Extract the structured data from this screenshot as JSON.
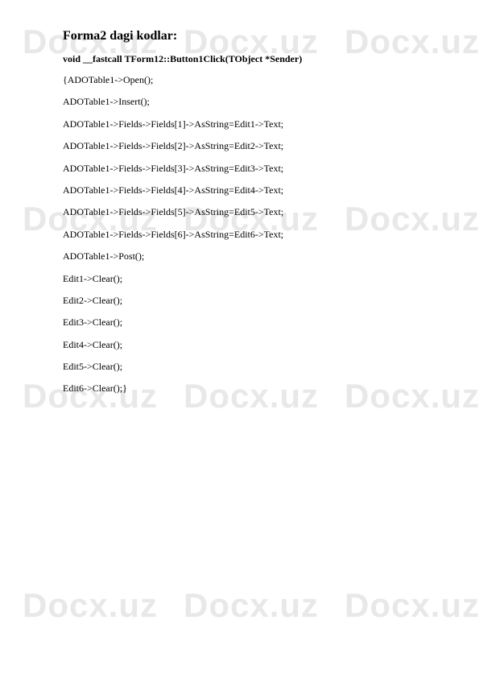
{
  "watermark": "Docx.uz",
  "heading": "Forma2 dagi kodlar:",
  "subheading": "void __fastcall TForm12::Button1Click(TObject *Sender)",
  "lines": [
    "{ADOTable1->Open();",
    "ADOTable1->Insert();",
    "ADOTable1->Fields->Fields[1]->AsString=Edit1->Text;",
    "ADOTable1->Fields->Fields[2]->AsString=Edit2->Text;",
    "ADOTable1->Fields->Fields[3]->AsString=Edit3->Text;",
    "ADOTable1->Fields->Fields[4]->AsString=Edit4->Text;",
    "ADOTable1->Fields->Fields[5]->AsString=Edit5->Text;",
    "ADOTable1->Fields->Fields[6]->AsString=Edit6->Text;",
    "ADOTable1->Post();",
    "Edit1->Clear();",
    "Edit2->Clear();",
    "Edit3->Clear();",
    "Edit4->Clear();",
    "Edit5->Clear();",
    "Edit6->Clear();}"
  ]
}
